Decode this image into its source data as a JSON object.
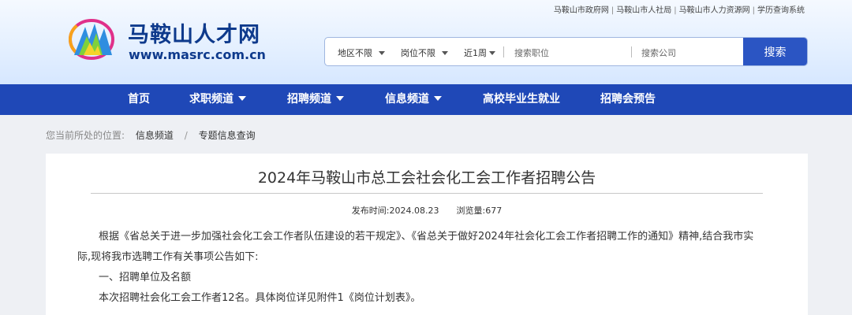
{
  "toplinks": [
    "马鞍山市政府网",
    "马鞍山市人社局",
    "马鞍山市人力资源网",
    "学历查询系统"
  ],
  "site": {
    "name": "马鞍山人才网",
    "url": "www.masrc.com.cn"
  },
  "search": {
    "region": "地区不限",
    "position": "岗位不限",
    "period": "近1周",
    "job_placeholder": "搜索职位",
    "company_placeholder": "搜索公司",
    "button": "搜索"
  },
  "nav": {
    "home": "首页",
    "job_seek": "求职频道",
    "recruit": "招聘频道",
    "info": "信息频道",
    "graduate": "高校毕业生就业",
    "fair": "招聘会预告"
  },
  "breadcrumb": {
    "prefix": "您当前所处的位置:",
    "level1": "信息频道",
    "level2": "专题信息查询"
  },
  "article": {
    "title": "2024年马鞍山市总工会社会化工会工作者招聘公告",
    "publish_label": "发布时间:",
    "publish_date": "2024.08.23",
    "views_label": "浏览量:",
    "views": "677",
    "para1_line1": "根据《省总关于进一步加强社会化工会工作者队伍建设的若干规定》、《省总关于做好2024年社会化工会工作者招聘工作的通知》精神,结合我市实",
    "para1_line2": "际,现将我市选聘工作有关事项公告如下:",
    "section1": "一、招聘单位及名额",
    "para2": "本次招聘社会化工会工作者12名。具体岗位详见附件1《岗位计划表》。"
  },
  "colors": {
    "nav_bg": "#1f48b7",
    "brand": "#0e3a8c",
    "search_button": "#2b55c3"
  }
}
